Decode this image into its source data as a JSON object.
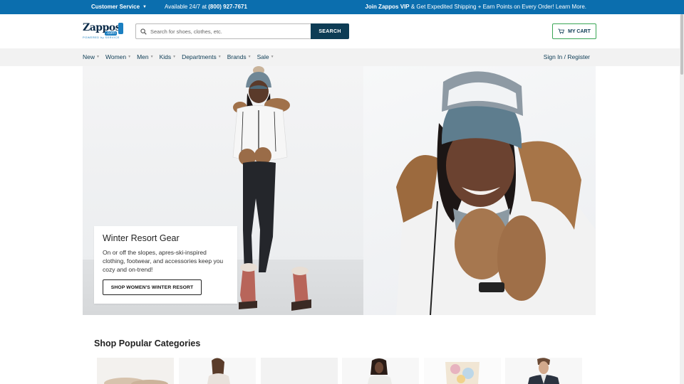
{
  "topbar": {
    "customer_service": "Customer Service",
    "availability_prefix": "Available 24/7 at",
    "phone": "(800) 927-7671",
    "vip_title": "Join Zappos VIP",
    "vip_text": "& Get Expedited Shipping + Earn Points on Every Order! Learn More."
  },
  "header": {
    "logo_word": "Zappos",
    "logo_dotcom": ".com",
    "logo_tagline": "POWERED by SERVICE",
    "search_placeholder": "Search for shoes, clothes, etc.",
    "search_button": "SEARCH",
    "cart_label": "MY CART"
  },
  "nav": {
    "items": [
      "New",
      "Women",
      "Men",
      "Kids",
      "Departments",
      "Brands",
      "Sale"
    ],
    "signin": "Sign In / Register"
  },
  "hero": {
    "heading": "Winter Resort Gear",
    "body": "On or off the slopes, apres-ski-inspired clothing, footwear, and accessories keep you cozy and on-trend!",
    "button": "SHOP WOMEN'S WINTER RESORT"
  },
  "categories": {
    "title": "Shop Popular Categories"
  },
  "colors": {
    "topbar_bg": "#0b6eae",
    "search_button_bg": "#0d3c55",
    "cart_border": "#3aa655",
    "nav_bg": "#f2f2f2"
  },
  "icons": [
    "search-icon",
    "cart-icon",
    "chevron-down-icon"
  ]
}
